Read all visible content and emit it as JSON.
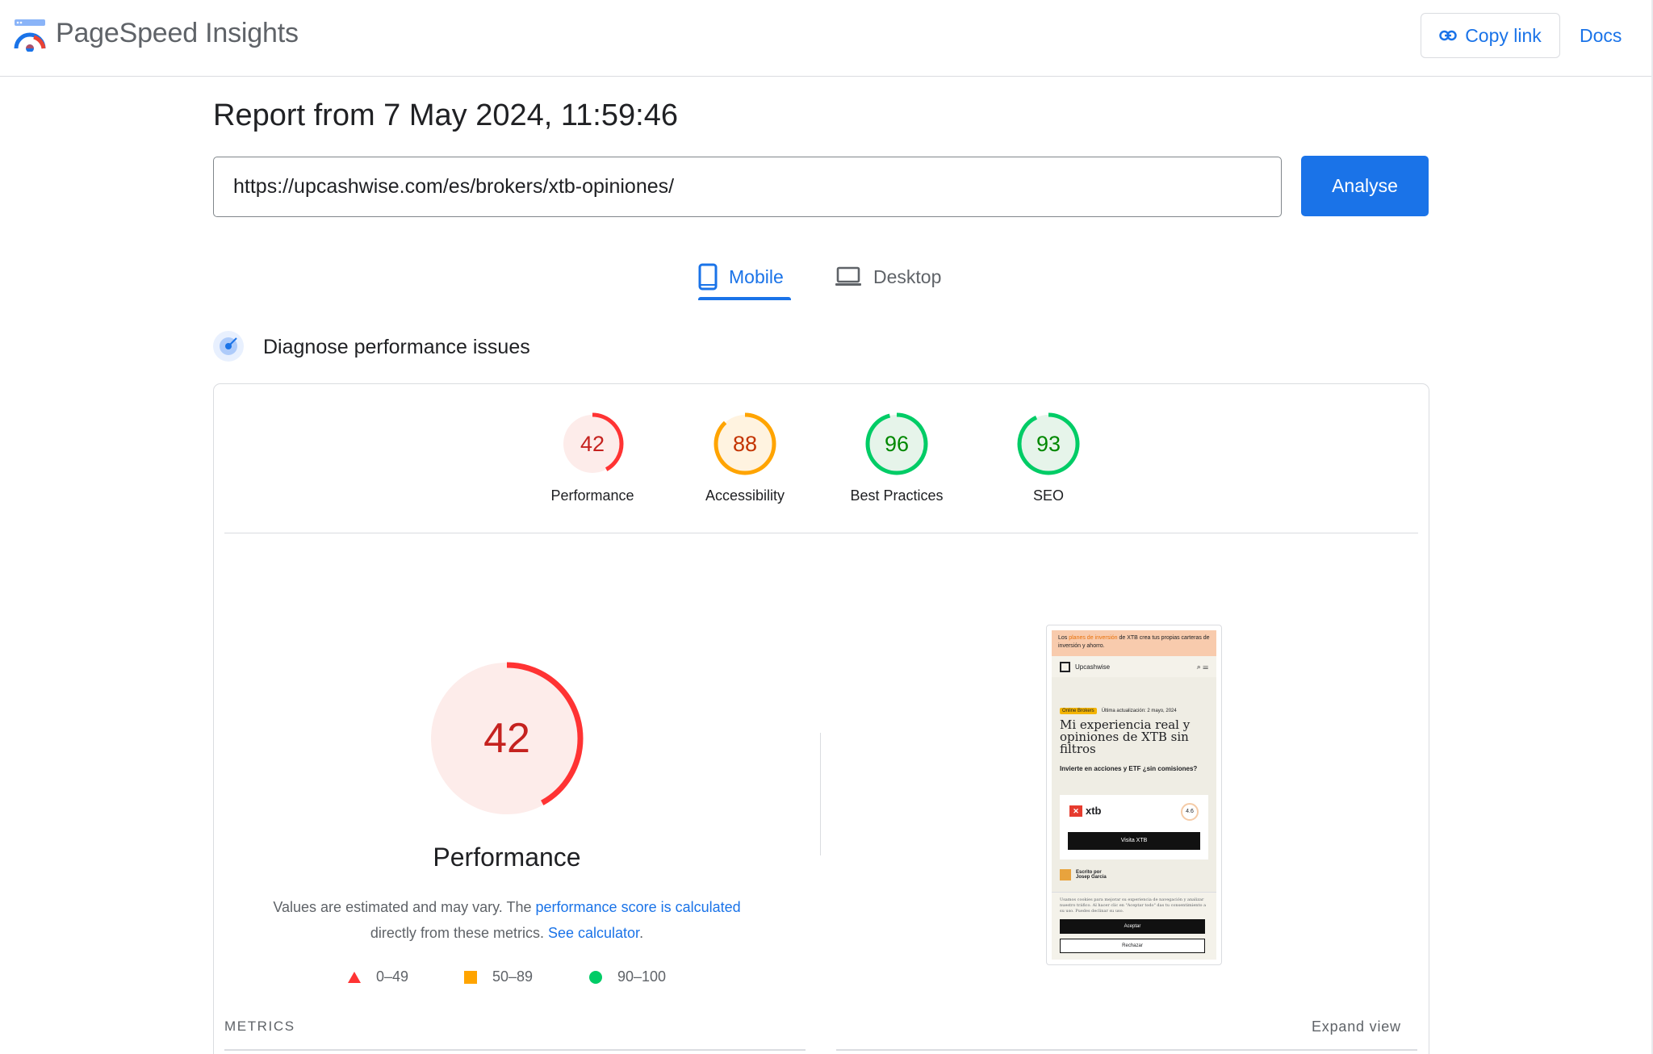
{
  "header": {
    "brand": "PageSpeed Insights",
    "copy_link_label": "Copy link",
    "docs_label": "Docs"
  },
  "report": {
    "title": "Report from 7 May 2024, 11:59:46",
    "url_value": "https://upcashwise.com/es/brokers/xtb-opiniones/",
    "analyse_label": "Analyse"
  },
  "tabs": [
    {
      "label": "Mobile",
      "active": true,
      "icon": "smartphone-icon"
    },
    {
      "label": "Desktop",
      "active": false,
      "icon": "laptop-icon"
    }
  ],
  "diagnose": {
    "title": "Diagnose performance issues",
    "icon": "target-icon"
  },
  "scores": [
    {
      "label": "Performance",
      "value": 42,
      "rating": "fail",
      "color": "#f33",
      "bg": "#fdecea",
      "text_color": "#c5221f"
    },
    {
      "label": "Accessibility",
      "value": 88,
      "rating": "average",
      "color": "#ffa400",
      "bg": "#fff3e0",
      "text_color": "#c33300"
    },
    {
      "label": "Best Practices",
      "value": 96,
      "rating": "pass",
      "color": "#0c6",
      "bg": "#e6f4ea",
      "text_color": "#080"
    },
    {
      "label": "SEO",
      "value": 93,
      "rating": "pass",
      "color": "#0c6",
      "bg": "#e6f4ea",
      "text_color": "#080"
    }
  ],
  "performance": {
    "score": 42,
    "label": "Performance",
    "desc_prefix": "Values are estimated and may vary. The ",
    "desc_link1": "performance score is calculated",
    "desc_middle": "directly from these metrics. ",
    "desc_link2": "See calculator",
    "desc_suffix": "."
  },
  "legend": [
    {
      "range": "0–49",
      "shape": "triangle",
      "color": "#f33"
    },
    {
      "range": "50–89",
      "shape": "square",
      "color": "#ffa400"
    },
    {
      "range": "90–100",
      "shape": "circle",
      "color": "#0c6"
    }
  ],
  "metrics": {
    "label": "METRICS",
    "expand_label": "Expand view"
  },
  "screenshot": {
    "banner_pre": "Los ",
    "banner_link": "planes de inversión",
    "banner_post": " de XTB crea tus propias carteras de inversión y ahorro.",
    "site_name": "Upcashwise",
    "tag": "Online Brokers",
    "updated": "Última actualización: 2 mayo, 2024",
    "title": "Mi experiencia real y opiniones de XTB sin filtros",
    "subtitle": "Invierte en acciones y ETF ¿sin comisiones?",
    "broker": "xtb",
    "rating": "4.6",
    "cta": "Visita XTB",
    "author_label": "Escrito por",
    "author_name": "Josep Garcia",
    "cookie_text": "Usamos cookies para mejorar su experiencia de navegación y analizar nuestro tráfico. Al hacer clic en \"Aceptar todo\" das tu consentimiento a su uso. Puedes declinar su uso.",
    "accept": "Aceptar",
    "reject": "Rechazar"
  }
}
